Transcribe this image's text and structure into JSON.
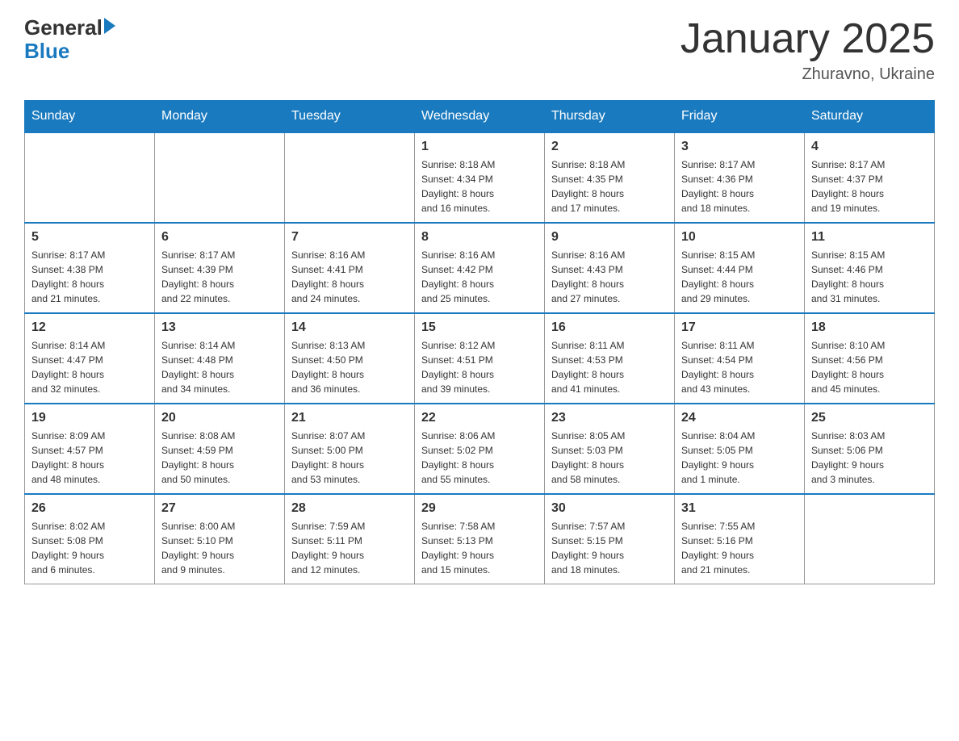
{
  "header": {
    "logo_text_general": "General",
    "logo_text_blue": "Blue",
    "title": "January 2025",
    "subtitle": "Zhuravno, Ukraine"
  },
  "weekdays": [
    "Sunday",
    "Monday",
    "Tuesday",
    "Wednesday",
    "Thursday",
    "Friday",
    "Saturday"
  ],
  "weeks": [
    [
      {
        "day": "",
        "info": ""
      },
      {
        "day": "",
        "info": ""
      },
      {
        "day": "",
        "info": ""
      },
      {
        "day": "1",
        "info": "Sunrise: 8:18 AM\nSunset: 4:34 PM\nDaylight: 8 hours\nand 16 minutes."
      },
      {
        "day": "2",
        "info": "Sunrise: 8:18 AM\nSunset: 4:35 PM\nDaylight: 8 hours\nand 17 minutes."
      },
      {
        "day": "3",
        "info": "Sunrise: 8:17 AM\nSunset: 4:36 PM\nDaylight: 8 hours\nand 18 minutes."
      },
      {
        "day": "4",
        "info": "Sunrise: 8:17 AM\nSunset: 4:37 PM\nDaylight: 8 hours\nand 19 minutes."
      }
    ],
    [
      {
        "day": "5",
        "info": "Sunrise: 8:17 AM\nSunset: 4:38 PM\nDaylight: 8 hours\nand 21 minutes."
      },
      {
        "day": "6",
        "info": "Sunrise: 8:17 AM\nSunset: 4:39 PM\nDaylight: 8 hours\nand 22 minutes."
      },
      {
        "day": "7",
        "info": "Sunrise: 8:16 AM\nSunset: 4:41 PM\nDaylight: 8 hours\nand 24 minutes."
      },
      {
        "day": "8",
        "info": "Sunrise: 8:16 AM\nSunset: 4:42 PM\nDaylight: 8 hours\nand 25 minutes."
      },
      {
        "day": "9",
        "info": "Sunrise: 8:16 AM\nSunset: 4:43 PM\nDaylight: 8 hours\nand 27 minutes."
      },
      {
        "day": "10",
        "info": "Sunrise: 8:15 AM\nSunset: 4:44 PM\nDaylight: 8 hours\nand 29 minutes."
      },
      {
        "day": "11",
        "info": "Sunrise: 8:15 AM\nSunset: 4:46 PM\nDaylight: 8 hours\nand 31 minutes."
      }
    ],
    [
      {
        "day": "12",
        "info": "Sunrise: 8:14 AM\nSunset: 4:47 PM\nDaylight: 8 hours\nand 32 minutes."
      },
      {
        "day": "13",
        "info": "Sunrise: 8:14 AM\nSunset: 4:48 PM\nDaylight: 8 hours\nand 34 minutes."
      },
      {
        "day": "14",
        "info": "Sunrise: 8:13 AM\nSunset: 4:50 PM\nDaylight: 8 hours\nand 36 minutes."
      },
      {
        "day": "15",
        "info": "Sunrise: 8:12 AM\nSunset: 4:51 PM\nDaylight: 8 hours\nand 39 minutes."
      },
      {
        "day": "16",
        "info": "Sunrise: 8:11 AM\nSunset: 4:53 PM\nDaylight: 8 hours\nand 41 minutes."
      },
      {
        "day": "17",
        "info": "Sunrise: 8:11 AM\nSunset: 4:54 PM\nDaylight: 8 hours\nand 43 minutes."
      },
      {
        "day": "18",
        "info": "Sunrise: 8:10 AM\nSunset: 4:56 PM\nDaylight: 8 hours\nand 45 minutes."
      }
    ],
    [
      {
        "day": "19",
        "info": "Sunrise: 8:09 AM\nSunset: 4:57 PM\nDaylight: 8 hours\nand 48 minutes."
      },
      {
        "day": "20",
        "info": "Sunrise: 8:08 AM\nSunset: 4:59 PM\nDaylight: 8 hours\nand 50 minutes."
      },
      {
        "day": "21",
        "info": "Sunrise: 8:07 AM\nSunset: 5:00 PM\nDaylight: 8 hours\nand 53 minutes."
      },
      {
        "day": "22",
        "info": "Sunrise: 8:06 AM\nSunset: 5:02 PM\nDaylight: 8 hours\nand 55 minutes."
      },
      {
        "day": "23",
        "info": "Sunrise: 8:05 AM\nSunset: 5:03 PM\nDaylight: 8 hours\nand 58 minutes."
      },
      {
        "day": "24",
        "info": "Sunrise: 8:04 AM\nSunset: 5:05 PM\nDaylight: 9 hours\nand 1 minute."
      },
      {
        "day": "25",
        "info": "Sunrise: 8:03 AM\nSunset: 5:06 PM\nDaylight: 9 hours\nand 3 minutes."
      }
    ],
    [
      {
        "day": "26",
        "info": "Sunrise: 8:02 AM\nSunset: 5:08 PM\nDaylight: 9 hours\nand 6 minutes."
      },
      {
        "day": "27",
        "info": "Sunrise: 8:00 AM\nSunset: 5:10 PM\nDaylight: 9 hours\nand 9 minutes."
      },
      {
        "day": "28",
        "info": "Sunrise: 7:59 AM\nSunset: 5:11 PM\nDaylight: 9 hours\nand 12 minutes."
      },
      {
        "day": "29",
        "info": "Sunrise: 7:58 AM\nSunset: 5:13 PM\nDaylight: 9 hours\nand 15 minutes."
      },
      {
        "day": "30",
        "info": "Sunrise: 7:57 AM\nSunset: 5:15 PM\nDaylight: 9 hours\nand 18 minutes."
      },
      {
        "day": "31",
        "info": "Sunrise: 7:55 AM\nSunset: 5:16 PM\nDaylight: 9 hours\nand 21 minutes."
      },
      {
        "day": "",
        "info": ""
      }
    ]
  ]
}
